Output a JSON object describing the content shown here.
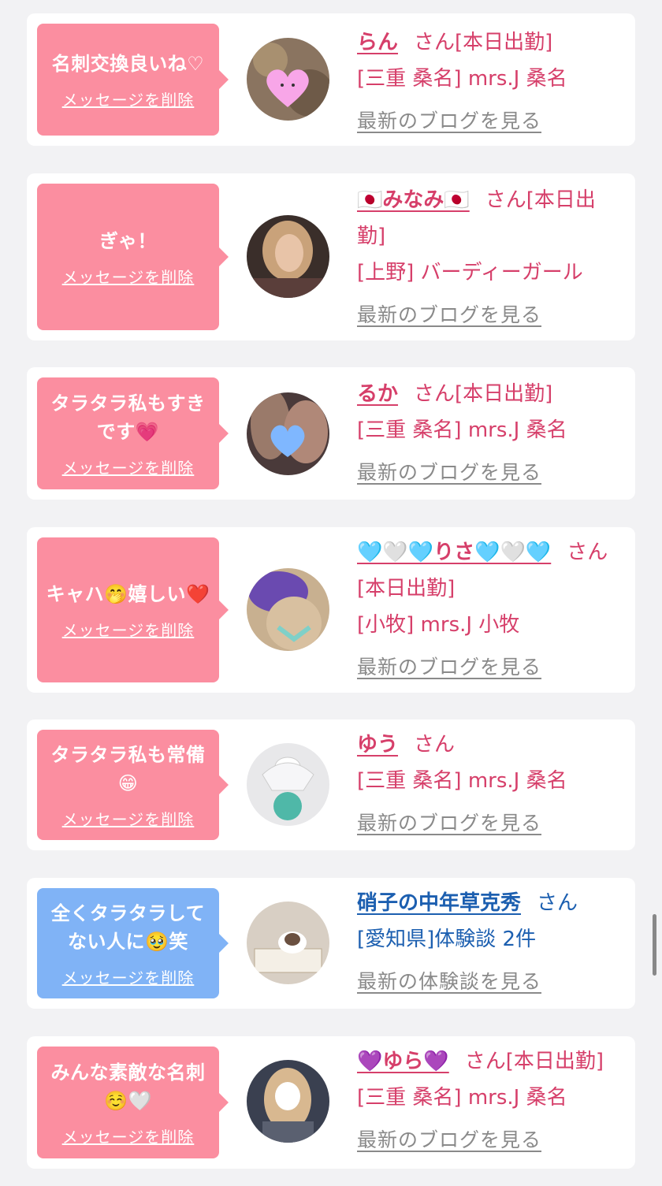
{
  "cards": [
    {
      "message": "名刺交換良いね♡",
      "delete_label": "メッセージを削除",
      "name": "らん",
      "suffix": "さん[本日出勤]",
      "location": "[三重 桑名] mrs.J 桑名",
      "link": "最新のブログを見る"
    },
    {
      "message": "ぎゃ！",
      "delete_label": "メッセージを削除",
      "name": "🇯🇵みなみ🇯🇵",
      "suffix": "さん[本日出勤]",
      "location": "[上野] バーディーガール",
      "link": "最新のブログを見る"
    },
    {
      "message": "タラタラ私もすきです💗",
      "delete_label": "メッセージを削除",
      "name": "るか",
      "suffix": "さん[本日出勤]",
      "location": "[三重 桑名] mrs.J 桑名",
      "link": "最新のブログを見る"
    },
    {
      "message": "キャハ🤭嬉しい❤️",
      "delete_label": "メッセージを削除",
      "name": "🩵🤍🩵りさ🩵🤍🩵",
      "suffix": "さん[本日出勤]",
      "location": "[小牧] mrs.J 小牧",
      "link": "最新のブログを見る"
    },
    {
      "message": "タラタラ私も常備😁",
      "delete_label": "メッセージを削除",
      "name": "ゆう",
      "suffix": "さん",
      "location": "[三重 桑名] mrs.J 桑名",
      "link": "最新のブログを見る"
    },
    {
      "message": "全くタラタラしてない人に🥹笑",
      "delete_label": "メッセージを削除",
      "name": "硝子の中年草克秀",
      "suffix": "さん",
      "location": "[愛知県]体験談 2件",
      "link": "最新の体験談を見る"
    },
    {
      "message": "みんな素敵な名刺☺️🤍",
      "delete_label": "メッセージを削除",
      "name": "💜ゆら💜",
      "suffix": "さん[本日出勤]",
      "location": "[三重 桑名] mrs.J 桑名",
      "link": "最新のブログを見る"
    }
  ],
  "colors": {
    "bubble_pink": "#fb8ea0",
    "bubble_blue": "#80b3f6",
    "name_pink": "#d63f6a",
    "name_blue": "#1c5fb0",
    "link_gray": "#8a8a8a"
  },
  "icons": [
    "heart-emoji-icon",
    "scroll-bar"
  ]
}
